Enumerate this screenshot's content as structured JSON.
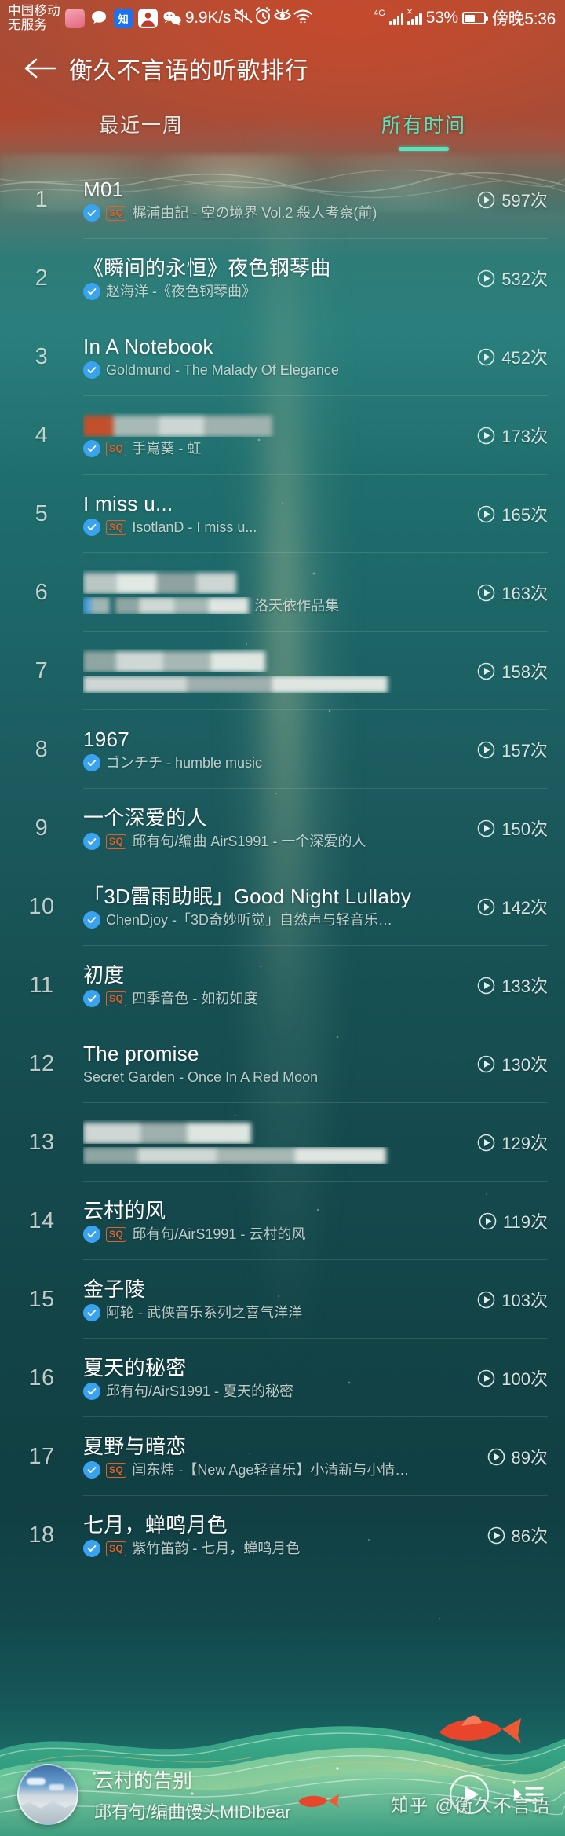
{
  "status_bar": {
    "carrier": "中国移动\n无服务",
    "network_speed": "9.9K/s",
    "battery_percent": "53%",
    "time": "傍晚5:36",
    "network_type": "4G",
    "icons": [
      "lulu-app-icon",
      "message-icon",
      "zhihu-icon",
      "contact-icon",
      "wechat-icon",
      "mute-icon",
      "alarm-icon",
      "eye-care-icon",
      "wifi-icon",
      "signal-icon",
      "battery-icon"
    ]
  },
  "header": {
    "back_label": "←",
    "title": "衡久不言语的听歌排行"
  },
  "tabs": [
    {
      "label": "最近一周",
      "active": false
    },
    {
      "label": "所有时间",
      "active": true
    }
  ],
  "accent_color": "#52e6c0",
  "vip_color": "#3aa3f0",
  "sq_color": "#e0622b",
  "plays_unit": "次",
  "sq_badge_label": "SQ",
  "rows": [
    {
      "rank": "1",
      "title": "M01",
      "title_redacted": false,
      "artist": "梶浦由記 - 空の境界 Vol.2 殺人考察(前)",
      "artist_redacted": false,
      "vip": true,
      "sq": true,
      "plays": "597次"
    },
    {
      "rank": "2",
      "title": "《瞬间的永恒》夜色钢琴曲",
      "title_redacted": false,
      "artist": "赵海洋 -《夜色钢琴曲》",
      "artist_redacted": false,
      "vip": true,
      "sq": false,
      "plays": "532次"
    },
    {
      "rank": "3",
      "title": "In A Notebook",
      "title_redacted": false,
      "artist": "Goldmund - The Malady Of Elegance",
      "artist_redacted": false,
      "vip": true,
      "sq": false,
      "plays": "452次"
    },
    {
      "rank": "4",
      "title": "",
      "title_redacted": true,
      "artist": "手嶌葵 - 虹",
      "artist_redacted": false,
      "vip": true,
      "sq": true,
      "plays": "173次"
    },
    {
      "rank": "5",
      "title": "I miss u...",
      "title_redacted": false,
      "artist": "IsotlanD - I miss u...",
      "artist_redacted": false,
      "vip": true,
      "sq": true,
      "plays": "165次"
    },
    {
      "rank": "6",
      "title": "",
      "title_redacted": true,
      "artist": "洛天依作品集",
      "artist_redacted": true,
      "vip": false,
      "sq": false,
      "plays": "163次"
    },
    {
      "rank": "7",
      "title": "",
      "title_redacted": true,
      "artist": "",
      "artist_redacted": true,
      "vip": false,
      "sq": false,
      "plays": "158次"
    },
    {
      "rank": "8",
      "title": "1967",
      "title_redacted": false,
      "artist": "ゴンチチ - humble music",
      "artist_redacted": false,
      "vip": true,
      "sq": false,
      "plays": "157次"
    },
    {
      "rank": "9",
      "title": "一个深爱的人",
      "title_redacted": false,
      "artist": "邱有句/编曲 AirS1991 - 一个深爱的人",
      "artist_redacted": false,
      "vip": true,
      "sq": true,
      "plays": "150次"
    },
    {
      "rank": "10",
      "title": "「3D雷雨助眠」Good Night Lullaby",
      "title_redacted": false,
      "artist": "ChenDjoy -「3D奇妙听觉」自然声与轻音乐…",
      "artist_redacted": false,
      "vip": true,
      "sq": false,
      "plays": "142次"
    },
    {
      "rank": "11",
      "title": "初度",
      "title_redacted": false,
      "artist": "四季音色 - 如初如度",
      "artist_redacted": false,
      "vip": true,
      "sq": true,
      "plays": "133次"
    },
    {
      "rank": "12",
      "title": "The promise",
      "title_redacted": false,
      "artist": "Secret Garden - Once In A Red Moon",
      "artist_redacted": false,
      "vip": false,
      "sq": false,
      "plays": "130次"
    },
    {
      "rank": "13",
      "title": "",
      "title_redacted": true,
      "artist": "",
      "artist_redacted": true,
      "vip": false,
      "sq": false,
      "plays": "129次"
    },
    {
      "rank": "14",
      "title": "云村的风",
      "title_redacted": false,
      "artist": "邱有句/AirS1991 - 云村的风",
      "artist_redacted": false,
      "vip": true,
      "sq": true,
      "plays": "119次"
    },
    {
      "rank": "15",
      "title": "金子陵",
      "title_redacted": false,
      "artist": "阿轮 - 武侠音乐系列之喜气洋洋",
      "artist_redacted": false,
      "vip": true,
      "sq": false,
      "plays": "103次"
    },
    {
      "rank": "16",
      "title": "夏天的秘密",
      "title_redacted": false,
      "artist": "邱有句/AirS1991 - 夏天的秘密",
      "artist_redacted": false,
      "vip": true,
      "sq": false,
      "plays": "100次"
    },
    {
      "rank": "17",
      "title": "夏野与暗恋",
      "title_redacted": false,
      "artist": "闫东炜 -【New Age轻音乐】小清新与小情…",
      "artist_redacted": false,
      "vip": true,
      "sq": true,
      "plays": "89次"
    },
    {
      "rank": "18",
      "title": "七月，蝉鸣月色",
      "title_redacted": false,
      "artist": "紫竹笛韵 - 七月，蝉鸣月色",
      "artist_redacted": false,
      "vip": true,
      "sq": true,
      "plays": "86次"
    }
  ],
  "player": {
    "song_title": "云村的告别",
    "song_artist": "邱有句/编曲馒头MIDIbear",
    "play_button": "play-icon",
    "playlist_button": "playlist-icon"
  },
  "watermark": "知乎 @衡久不言语"
}
